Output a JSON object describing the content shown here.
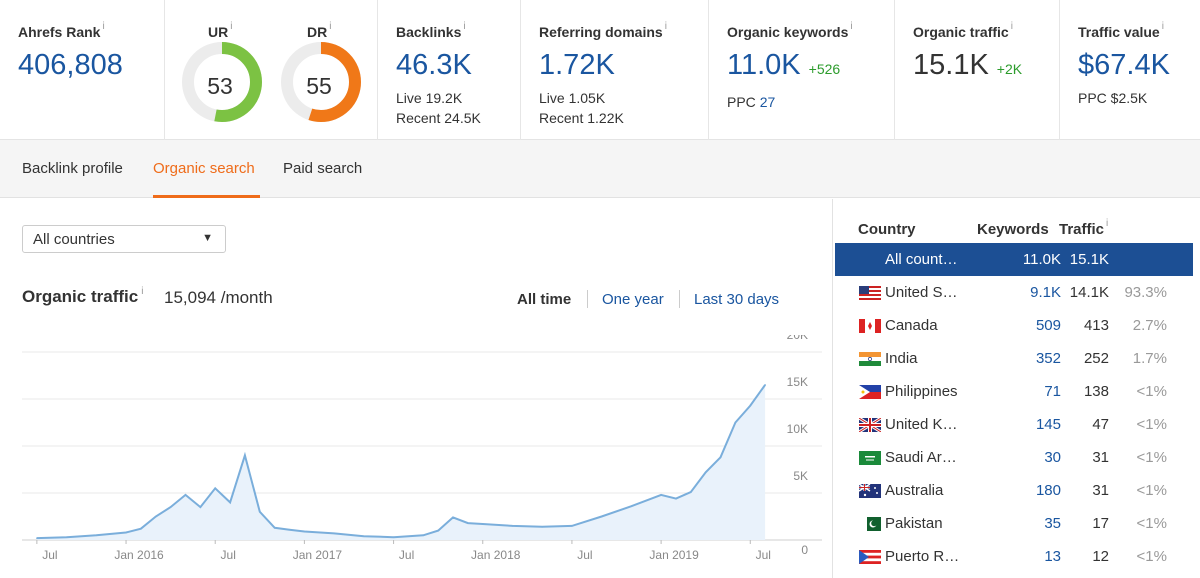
{
  "metrics": {
    "ahrefs_rank": {
      "label": "Ahrefs Rank",
      "value": "406,808"
    },
    "ur": {
      "label": "UR",
      "value": "53",
      "score": 53,
      "color": "#7cc243"
    },
    "dr": {
      "label": "DR",
      "value": "55",
      "score": 55,
      "color": "#f07818"
    },
    "backlinks": {
      "label": "Backlinks",
      "value": "46.3K",
      "sub1": "Live 19.2K",
      "sub2": "Recent 24.5K"
    },
    "referring_domains": {
      "label": "Referring domains",
      "value": "1.72K",
      "sub1": "Live 1.05K",
      "sub2": "Recent 1.22K"
    },
    "organic_keywords": {
      "label": "Organic keywords",
      "value": "11.0K",
      "delta": "+526",
      "ppc_label": "PPC",
      "ppc_value": "27"
    },
    "organic_traffic": {
      "label": "Organic traffic",
      "value": "15.1K",
      "delta": "+2K"
    },
    "traffic_value": {
      "label": "Traffic value",
      "value": "$67.4K",
      "sub1": "PPC $2.5K"
    },
    "info_glyph": "i"
  },
  "tabs": [
    {
      "label": "Backlink profile",
      "active": false
    },
    {
      "label": "Organic search",
      "active": true
    },
    {
      "label": "Paid search",
      "active": false
    }
  ],
  "country_select": {
    "value": "All countries"
  },
  "organic_traffic_panel": {
    "title": "Organic traffic",
    "value": "15,094 /month",
    "ranges": [
      "All time",
      "One year",
      "Last 30 days"
    ],
    "active_range": "All time"
  },
  "chart_data": {
    "type": "area",
    "title": "",
    "xlabel": "",
    "ylabel": "",
    "ylim": [
      0,
      20000
    ],
    "y_ticks": [
      "20K",
      "15K",
      "10K",
      "5K",
      "0"
    ],
    "x_ticks": [
      "Jul",
      "Jan 2016",
      "Jul",
      "Jan 2017",
      "Jul",
      "Jan 2018",
      "Jul",
      "Jan 2019",
      "Jul"
    ],
    "grid": true,
    "color": "#7aaedb",
    "fill": "#e9f2fb",
    "x": [
      "2015-07",
      "2015-09",
      "2015-11",
      "2016-01",
      "2016-02",
      "2016-03",
      "2016-04",
      "2016-05",
      "2016-06",
      "2016-07",
      "2016-08",
      "2016-09",
      "2016-10",
      "2016-11",
      "2016-12",
      "2017-01",
      "2017-03",
      "2017-05",
      "2017-07",
      "2017-09",
      "2017-10",
      "2017-11",
      "2017-12",
      "2018-01",
      "2018-03",
      "2018-05",
      "2018-07",
      "2018-09",
      "2018-11",
      "2019-01",
      "2019-02",
      "2019-03",
      "2019-04",
      "2019-05",
      "2019-06",
      "2019-07",
      "2019-08"
    ],
    "series": [
      {
        "values": [
          200,
          300,
          500,
          800,
          1200,
          2500,
          3500,
          4800,
          3500,
          5500,
          4000,
          9000,
          3000,
          1300,
          1100,
          900,
          700,
          400,
          300,
          500,
          1000,
          2400,
          1800,
          1700,
          1500,
          1400,
          1500,
          2500,
          3600,
          4800,
          4400,
          5100,
          7200,
          8800,
          12500,
          14300,
          16500
        ]
      }
    ]
  },
  "country_table": {
    "headers": {
      "country": "Country",
      "keywords": "Keywords",
      "traffic": "Traffic"
    },
    "rows": [
      {
        "country": "All count…",
        "keywords": "11.0K",
        "traffic": "15.1K",
        "pct": "",
        "flag": "none",
        "selected": true
      },
      {
        "country": "United S…",
        "keywords": "9.1K",
        "traffic": "14.1K",
        "pct": "93.3%",
        "flag": "us-flag-icon",
        "selected": false
      },
      {
        "country": "Canada",
        "keywords": "509",
        "traffic": "413",
        "pct": "2.7%",
        "flag": "ca-flag-icon",
        "selected": false
      },
      {
        "country": "India",
        "keywords": "352",
        "traffic": "252",
        "pct": "1.7%",
        "flag": "in-flag-icon",
        "selected": false
      },
      {
        "country": "Philippines",
        "keywords": "71",
        "traffic": "138",
        "pct": " <1%",
        "flag": "ph-flag-icon",
        "selected": false
      },
      {
        "country": "United K…",
        "keywords": "145",
        "traffic": "47",
        "pct": " <1%",
        "flag": "uk-flag-icon",
        "selected": false
      },
      {
        "country": "Saudi Ar…",
        "keywords": "30",
        "traffic": "31",
        "pct": " <1%",
        "flag": "sa-flag-icon",
        "selected": false
      },
      {
        "country": "Australia",
        "keywords": "180",
        "traffic": "31",
        "pct": " <1%",
        "flag": "au-flag-icon",
        "selected": false
      },
      {
        "country": "Pakistan",
        "keywords": "35",
        "traffic": "17",
        "pct": " <1%",
        "flag": "pk-flag-icon",
        "selected": false
      },
      {
        "country": "Puerto R…",
        "keywords": "13",
        "traffic": "12",
        "pct": " <1%",
        "flag": "pr-flag-icon",
        "selected": false
      }
    ]
  }
}
